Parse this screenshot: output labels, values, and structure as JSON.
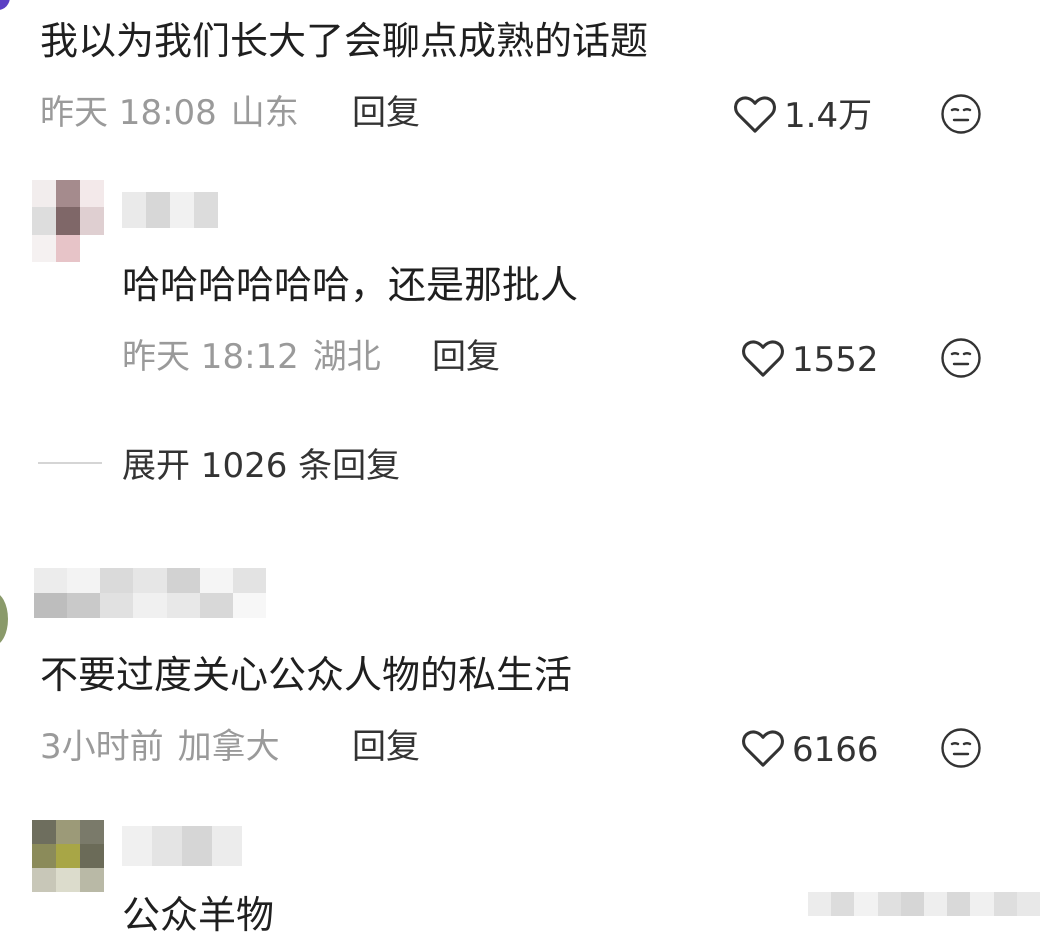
{
  "comments": [
    {
      "text": "我以为我们长大了会聊点成熟的话题",
      "time": "昨天 18:08",
      "location": "山东",
      "reply_label": "回复",
      "likes": "1.4万"
    },
    {
      "text": "哈哈哈哈哈哈，还是那批人",
      "time": "昨天 18:12",
      "location": "湖北",
      "reply_label": "回复",
      "likes": "1552"
    },
    {
      "text": "不要过度关心公众人物的私生活",
      "time": "3小时前",
      "location": "加拿大",
      "reply_label": "回复",
      "likes": "6166"
    },
    {
      "text": "公众羊物"
    }
  ],
  "expand_replies": "展开 1026 条回复",
  "icons": {
    "like": "heart-outline-icon",
    "dislike": "neutral-face-icon"
  },
  "colors": {
    "avatar_ring_top": "#5b3fc4",
    "meta_gray": "#9a9a9a",
    "text_dark": "#1f1f1f"
  }
}
